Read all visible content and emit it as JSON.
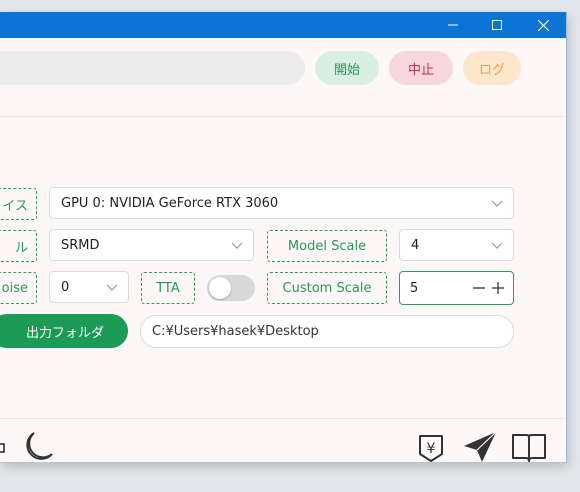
{
  "toolbar": {
    "start_label": "開始",
    "stop_label": "中止",
    "log_label": "ログ"
  },
  "settings": {
    "device_label": "イス",
    "device_value": "GPU 0: NVIDIA GeForce RTX 3060",
    "model_label": "ル",
    "model_value": "SRMD",
    "model_scale_label": "Model Scale",
    "model_scale_value": "4",
    "denoise_label": "oise",
    "denoise_value": "0",
    "tta_label": "TTA",
    "tta_enabled": false,
    "custom_scale_label": "Custom Scale",
    "custom_scale_value": "5"
  },
  "output": {
    "button_label": "出力フォルダ",
    "path": "C:¥Users¥hasek¥Desktop"
  },
  "icons": {
    "minimize": "minimize-icon",
    "maximize": "maximize-icon",
    "close": "close-icon",
    "moon": "moon-icon",
    "yen": "yen-icon",
    "send": "send-icon",
    "book": "book-icon"
  },
  "colors": {
    "accent": "#1c9b56",
    "titlebar": "#0b74d4",
    "stop": "#c8324a",
    "log": "#e8a344"
  }
}
